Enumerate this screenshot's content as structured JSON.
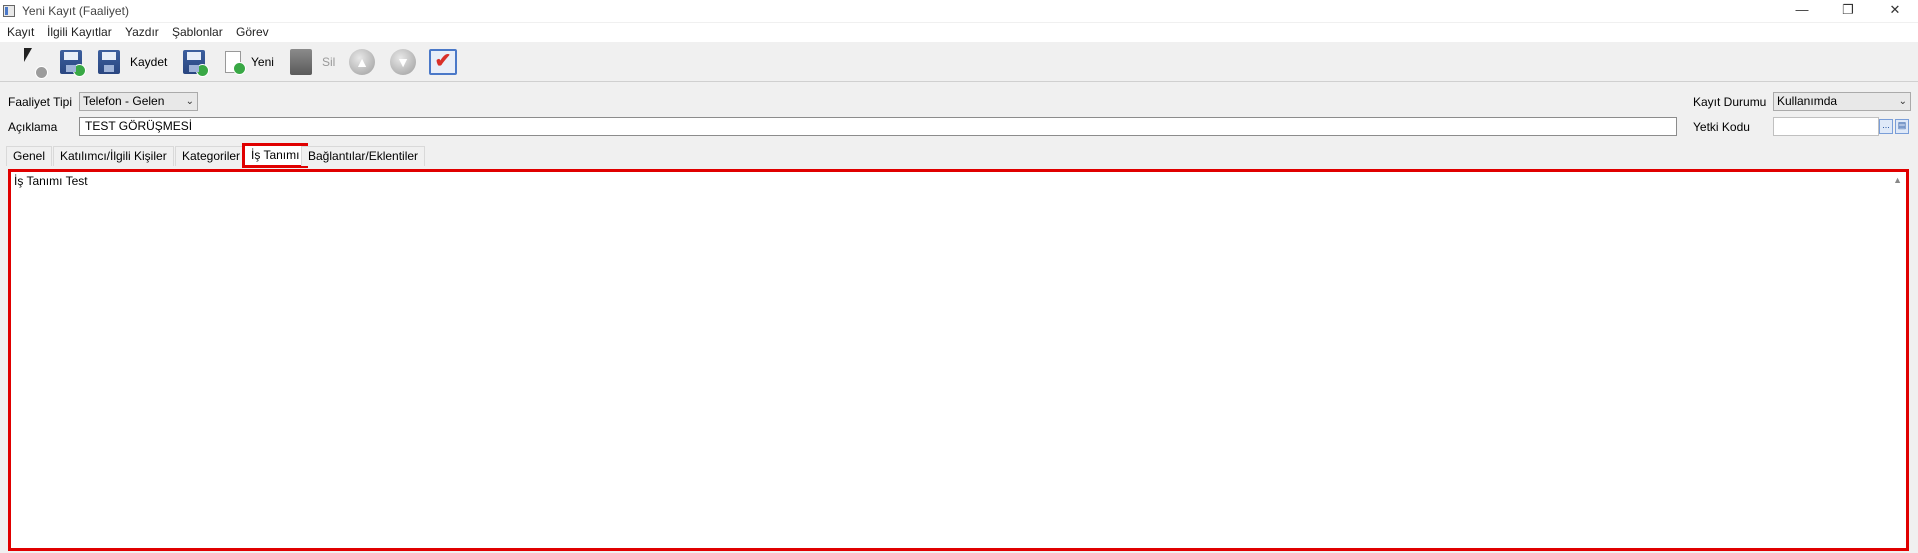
{
  "window": {
    "title": "Yeni Kayıt (Faaliyet)",
    "controls": {
      "minimize": "—",
      "restore": "❐",
      "close": "✕"
    }
  },
  "menu": [
    "Kayıt",
    "İlgili Kayıtlar",
    "Yazdır",
    "Şablonlar",
    "Görev"
  ],
  "toolbar": {
    "save_label": "Kaydet",
    "new_label": "Yeni",
    "delete_label": "Sil",
    "up_glyph": "▲",
    "down_glyph": "▼",
    "check_glyph": "✔",
    "icons": [
      "cursor-add-icon",
      "save-refresh-icon",
      "save-icon",
      "save-add-icon",
      "new-document-icon",
      "delete-icon",
      "up-arrow-icon",
      "down-arrow-icon",
      "approve-check-icon"
    ]
  },
  "form": {
    "activity_type_label": "Faaliyet Tipi",
    "activity_type_value": "Telefon - Gelen",
    "description_label": "Açıklama",
    "description_value": "TEST GÖRÜŞMESİ",
    "record_status_label": "Kayıt Durumu",
    "record_status_value": "Kullanımda",
    "auth_code_label": "Yetki Kodu",
    "auth_code_value": "",
    "lookup_glyph": "...",
    "calendar_glyph": "▤"
  },
  "tabs": [
    "Genel",
    "Katılımcı/İlgili Kişiler",
    "Kategoriler",
    "İş Tanımı",
    "Bağlantılar/Eklentiler"
  ],
  "active_tab": "İş Tanımı",
  "job_description_text": "İş Tanımı Test",
  "colors": {
    "highlight": "#e00000",
    "accent": "#4a78c8"
  }
}
